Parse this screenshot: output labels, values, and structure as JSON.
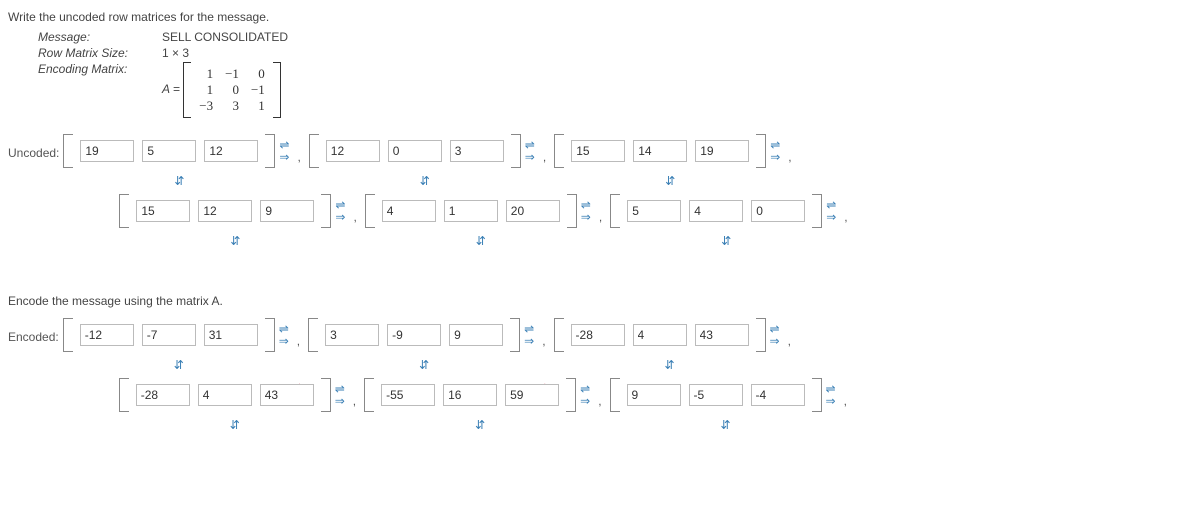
{
  "prompt1": "Write the uncoded row matrices for the message.",
  "defs": {
    "message_k": "Message:",
    "message_v": "SELL CONSOLIDATED",
    "size_k": "Row Matrix Size:",
    "size_v": "1 × 3",
    "enc_k": "Encoding Matrix:",
    "enc_eq": "A ="
  },
  "A": [
    [
      "1",
      "−1",
      "0"
    ],
    [
      "1",
      "0",
      "−1"
    ],
    [
      "−3",
      "3",
      "1"
    ]
  ],
  "uncoded_label": "Uncoded:",
  "uncoded": {
    "r1": [
      {
        "v": [
          "19",
          "5",
          "12"
        ],
        "ok": true
      },
      {
        "v": [
          "12",
          "0",
          "3"
        ],
        "ok": true
      },
      {
        "v": [
          "15",
          "14",
          "19"
        ],
        "ok": true
      }
    ],
    "r2": [
      {
        "v": [
          "15",
          "12",
          "9"
        ],
        "ok": true
      },
      {
        "v": [
          "4",
          "1",
          "20"
        ],
        "ok": true
      },
      {
        "v": [
          "5",
          "4",
          "0"
        ],
        "ok": true
      }
    ]
  },
  "prompt2": "Encode the message using the matrix A.",
  "encoded_label": "Encoded:",
  "encoded": {
    "r1": [
      {
        "v": [
          "-12",
          "-7",
          "31"
        ],
        "ok": false
      },
      {
        "v": [
          "3",
          "-9",
          "9"
        ],
        "ok": false
      },
      {
        "v": [
          "-28",
          "4",
          "43"
        ],
        "ok": false
      }
    ],
    "r2": [
      {
        "v": [
          "-28",
          "4",
          "43"
        ],
        "ok": false
      },
      {
        "v": [
          "-55",
          "16",
          "59"
        ],
        "ok": false
      },
      {
        "v": [
          "9",
          "-5",
          "-4"
        ],
        "ok": true
      }
    ]
  },
  "under_sym": "⇵",
  "arrow_top": "⇌",
  "arrow_bot": "⇒",
  "comma": ",",
  "ok_sym": "✔",
  "bad_sym": "✘"
}
